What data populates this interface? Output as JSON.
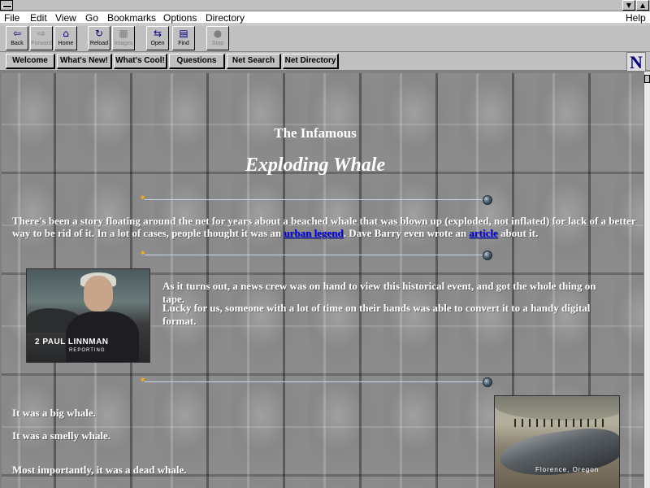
{
  "window": {
    "controls": [
      "▼",
      "▲"
    ]
  },
  "menubar": {
    "items": [
      "File",
      "Edit",
      "View",
      "Go",
      "Bookmarks",
      "Options",
      "Directory"
    ],
    "help": "Help"
  },
  "toolbar": {
    "buttons": [
      {
        "label": "Back",
        "icon": "back-arrow-icon",
        "glyph": "⇦"
      },
      {
        "label": "Forward",
        "icon": "forward-arrow-icon",
        "glyph": "⇨",
        "disabled": true
      },
      {
        "label": "Home",
        "icon": "home-icon",
        "glyph": "⌂"
      },
      {
        "label": "Reload",
        "icon": "reload-icon",
        "glyph": "↻"
      },
      {
        "label": "Images",
        "icon": "images-icon",
        "glyph": "▦",
        "disabled": true
      },
      {
        "label": "Open",
        "icon": "open-icon",
        "glyph": "⇆"
      },
      {
        "label": "Find",
        "icon": "find-icon",
        "glyph": "▤"
      },
      {
        "label": "Stop",
        "icon": "stop-icon",
        "glyph": "●",
        "disabled": true
      }
    ]
  },
  "directory_buttons": [
    "Welcome",
    "What's New!",
    "What's Cool!",
    "Questions",
    "Net Search",
    "Net Directory"
  ],
  "logo": "N",
  "page": {
    "heading_small": "The Infamous",
    "heading_large": "Exploding Whale",
    "intro_before_link1": "There's been a story floating around the net for years about a beached whale that was blown up (exploded, not inflated) for lack of a better way to be rid of it. In a lot of cases, people thought it was an ",
    "link1": "urban legend",
    "intro_between_links": ". Dave Barry even wrote an ",
    "link2": "article",
    "intro_after_link2": " about it.",
    "para2": "As it turns out, a news crew was on hand to view this historical event, and got the whole thing on tape.",
    "para3": "Lucky for us, someone with a lot of time on their hands was able to convert it to a handy digital format.",
    "photo1_caption": "2 PAUL LINNMAN",
    "photo1_subcaption": "REPORTING",
    "line1": "It was a big whale.",
    "line2": "It was a smelly whale.",
    "line3": "Most importantly, it was a dead whale.",
    "photo2_caption": "Florence, Oregon"
  },
  "colors": {
    "link": "#0000ee",
    "text": "#ffffff",
    "chrome": "#c0c0c0"
  }
}
